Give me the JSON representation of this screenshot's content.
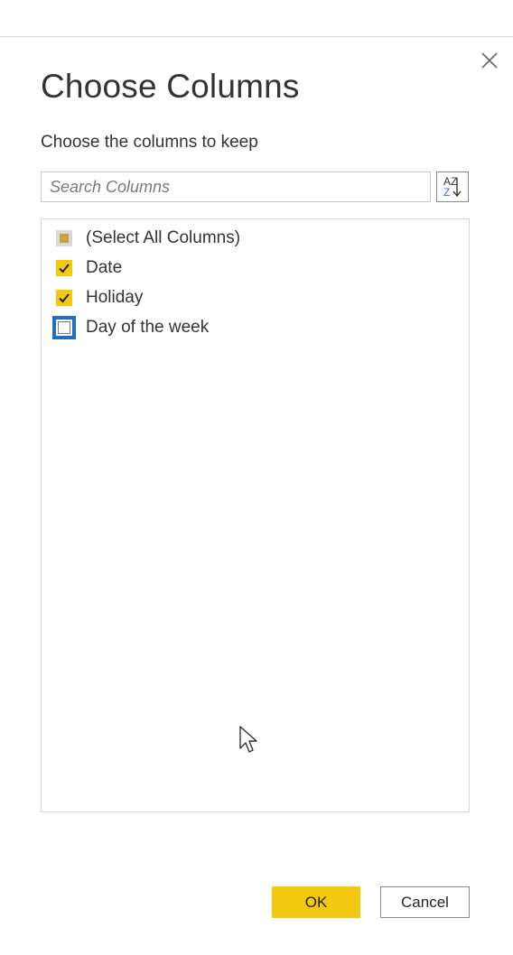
{
  "dialog": {
    "title": "Choose Columns",
    "subtitle": "Choose the columns to keep",
    "close_icon": "close-icon"
  },
  "search": {
    "placeholder": "Search Columns",
    "value": ""
  },
  "sort": {
    "icon": "sort-az-icon",
    "label": "AZ"
  },
  "columns": {
    "items": [
      {
        "label": "(Select All Columns)",
        "state": "indeterminate"
      },
      {
        "label": "Date",
        "state": "checked"
      },
      {
        "label": "Holiday",
        "state": "checked"
      },
      {
        "label": "Day of the week",
        "state": "unchecked"
      }
    ]
  },
  "buttons": {
    "ok_label": "OK",
    "cancel_label": "Cancel"
  },
  "colors": {
    "accent": "#F2C811",
    "focus": "#1F6FC4",
    "border": "#C8C6C4"
  }
}
